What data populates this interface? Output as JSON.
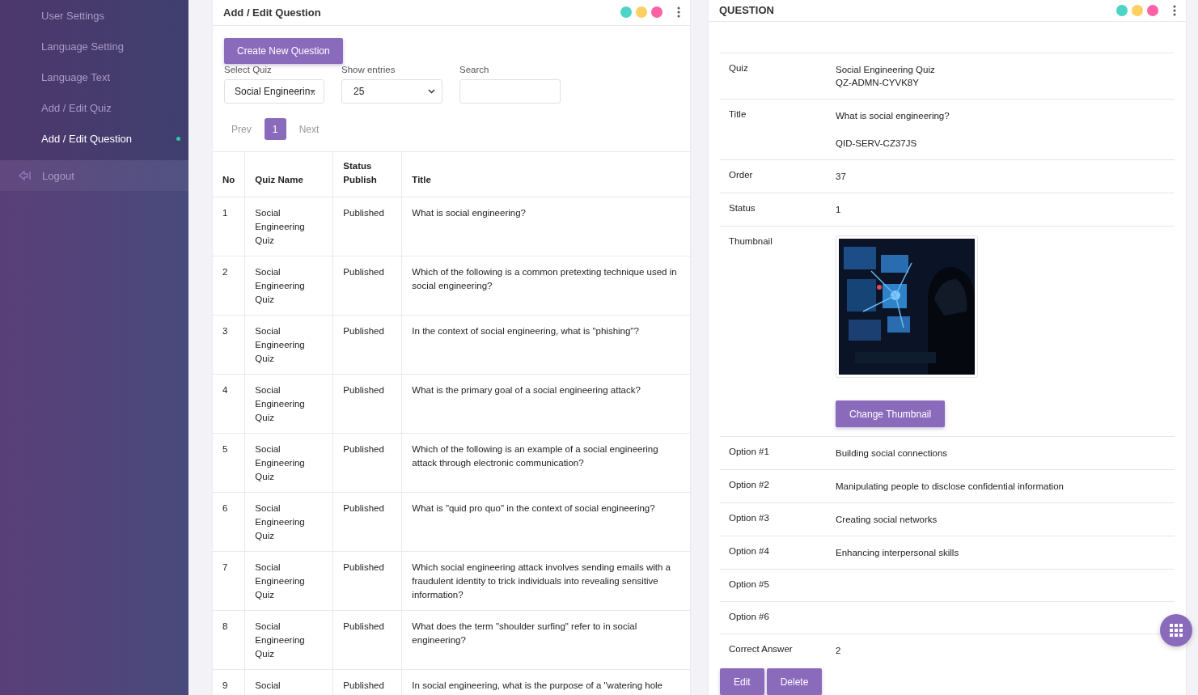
{
  "sidebar": {
    "items": [
      {
        "label": "User Settings",
        "selected": false
      },
      {
        "label": "Language Setting",
        "selected": false
      },
      {
        "label": "Language Text",
        "selected": false
      },
      {
        "label": "Add / Edit Quiz",
        "selected": false
      },
      {
        "label": "Add / Edit Question",
        "selected": true
      }
    ],
    "logout": "Logout"
  },
  "list_card": {
    "title": "Add / Edit Question",
    "dots": [
      {
        "color": "#4dd4c4"
      },
      {
        "color": "#fecf63"
      },
      {
        "color": "#fd62a4"
      }
    ],
    "create_button": "Create New Question",
    "select_quiz": {
      "label": "Select Quiz",
      "value": "Social Engineerin.."
    },
    "show_entries": {
      "label": "Show entries",
      "value": "25"
    },
    "search": {
      "label": "Search"
    },
    "pagination": {
      "prev": "Prev",
      "pages": [
        {
          "label": "1",
          "selected": true
        }
      ],
      "next": "Next"
    },
    "table": {
      "columns": [
        "No",
        "Quiz Name",
        "Status\nPublish",
        "Title"
      ],
      "rows": [
        [
          "1",
          "Social Engineering Quiz",
          "Published",
          "What is social engineering?"
        ],
        [
          "2",
          "Social Engineering Quiz",
          "Published",
          "Which of the following is a common pretexting technique used in social engineering?"
        ],
        [
          "3",
          "Social Engineering Quiz",
          "Published",
          "In the context of social engineering, what is \"phishing\"?"
        ],
        [
          "4",
          "Social Engineering Quiz",
          "Published",
          "What is the primary goal of a social engineering attack?"
        ],
        [
          "5",
          "Social Engineering Quiz",
          "Published",
          "Which of the following is an example of a social engineering attack through electronic communication?"
        ],
        [
          "6",
          "Social Engineering Quiz",
          "Published",
          "What is \"quid pro quo\" in the context of social engineering?"
        ],
        [
          "7",
          "Social Engineering Quiz",
          "Published",
          "Which social engineering attack involves sending emails with a fraudulent identity to trick individuals into revealing sensitive information?"
        ],
        [
          "8",
          "Social Engineering Quiz",
          "Published",
          "What does the term \"shoulder surfing\" refer to in social engineering?"
        ],
        [
          "9",
          "Social",
          "Published",
          "In social engineering, what is the purpose of a \"watering hole"
        ]
      ]
    }
  },
  "detail_card": {
    "title": "QUESTION",
    "dots": [
      {
        "color": "#4dd4c4"
      },
      {
        "color": "#fecf63"
      },
      {
        "color": "#fd62a4"
      }
    ],
    "fields": [
      {
        "kind": "text",
        "label": "Quiz",
        "lines": [
          "Social Engineering Quiz",
          "QZ-ADMN-CYVK8Y"
        ]
      },
      {
        "kind": "gap",
        "label": "Title",
        "lines": [
          "What is social engineering?",
          "QID-SERV-CZ37JS"
        ]
      },
      {
        "kind": "text",
        "label": "Order",
        "lines": [
          "37"
        ]
      },
      {
        "kind": "text",
        "label": "Status",
        "lines": [
          "1"
        ]
      },
      {
        "label": "Thumbnail",
        "button": "Change Thumbnail"
      },
      {
        "kind": "text",
        "label": "Option #1",
        "lines": [
          "Building social connections"
        ]
      },
      {
        "kind": "text",
        "label": "Option #2",
        "lines": [
          "Manipulating people to disclose confidential information"
        ]
      },
      {
        "kind": "text",
        "label": "Option #3",
        "lines": [
          "Creating social networks"
        ]
      },
      {
        "kind": "text",
        "label": "Option #4",
        "lines": [
          "Enhancing interpersonal skills"
        ]
      },
      {
        "kind": "text",
        "label": "Option #5"
      },
      {
        "kind": "text",
        "label": "Option #6"
      },
      {
        "kind": "text",
        "label": "Correct Answer",
        "lines": [
          "2"
        ]
      }
    ],
    "buttons": [
      "Edit",
      "Delete"
    ]
  }
}
